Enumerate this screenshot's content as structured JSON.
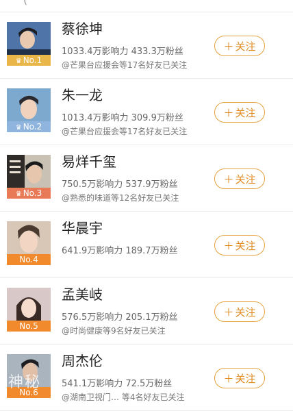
{
  "header_ghost": "(",
  "follow_label": "关注",
  "users": [
    {
      "name": "蔡徐坤",
      "stats": "1033.4万影响力 433.3万粉丝",
      "mutual": "@芒果台应援会等17名好友已关注",
      "rank": "No.1",
      "rank_style": "gold"
    },
    {
      "name": "朱一龙",
      "stats": "1013.4万影响力 309.9万粉丝",
      "mutual": "@芒果台应援会等17名好友已关注",
      "rank": "No.2",
      "rank_style": "silver"
    },
    {
      "name": "易烊千玺",
      "stats": "750.5万影响力 537.9万粉丝",
      "mutual": "@熟悉的味道等12名好友已关注",
      "rank": "No.3",
      "rank_style": "bronze"
    },
    {
      "name": "华晨宇",
      "stats": "641.9万影响力 189.7万粉丝",
      "mutual": "",
      "rank": "No.4",
      "rank_style": "plain"
    },
    {
      "name": "孟美岐",
      "stats": "576.5万影响力 205.1万粉丝",
      "mutual": "@时尚健康等9名好友已关注",
      "rank": "No.5",
      "rank_style": "plain"
    },
    {
      "name": "周杰伦",
      "stats": "541.1万影响力 72.5万粉丝",
      "mutual": "@湖南卫视门… 等4名好友已关注",
      "rank": "No.6",
      "rank_style": "plain"
    }
  ],
  "watermark": "神秘",
  "colors": {
    "accent": "#e08a1e",
    "rank1": "#e9b64a",
    "rank2": "#8fb4de",
    "rank3": "#e97a57",
    "rankn": "#f08a2c"
  }
}
